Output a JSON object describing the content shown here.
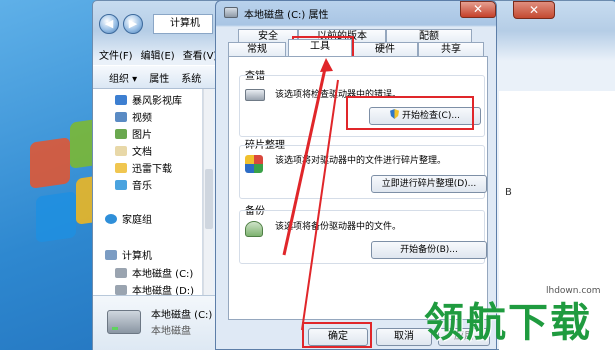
{
  "explorer": {
    "address": "计算机",
    "menu": [
      "文件(F)",
      "编辑(E)",
      "查看(V)"
    ],
    "toolbar": [
      "组织 ▾",
      "属性",
      "系统"
    ],
    "sidebar": [
      "暴风影视库",
      "视频",
      "图片",
      "文档",
      "迅雷下载",
      "音乐",
      "家庭组",
      "计算机",
      "本地磁盘 (C:)",
      "本地磁盘 (D:)"
    ],
    "details": {
      "name": "本地磁盘 (C:)",
      "type": "本地磁盘"
    },
    "content_glyph": "B"
  },
  "dialog": {
    "title": "本地磁盘 (C:) 属性",
    "close": "✕",
    "tabs_top": [
      "安全",
      "以前的版本",
      "配额"
    ],
    "tabs_bottom": [
      "常规",
      "工具",
      "硬件",
      "共享"
    ],
    "active_tab": "工具",
    "groups": [
      {
        "label": "查错",
        "desc": "该选项将检查驱动器中的错误。",
        "button": "开始检查(C)..."
      },
      {
        "label": "碎片整理",
        "desc": "该选项将对驱动器中的文件进行碎片整理。",
        "button": "立即进行碎片整理(D)..."
      },
      {
        "label": "备份",
        "desc": "该选项将备份驱动器中的文件。",
        "button": "开始备份(B)..."
      }
    ],
    "ok": "确定",
    "cancel": "取消",
    "apply": "应用"
  },
  "watermark": {
    "text": "领航下载",
    "url": "lhdown.com"
  },
  "colors": {
    "highlight": "#e0262a",
    "watermark": "#1f9b3f"
  }
}
